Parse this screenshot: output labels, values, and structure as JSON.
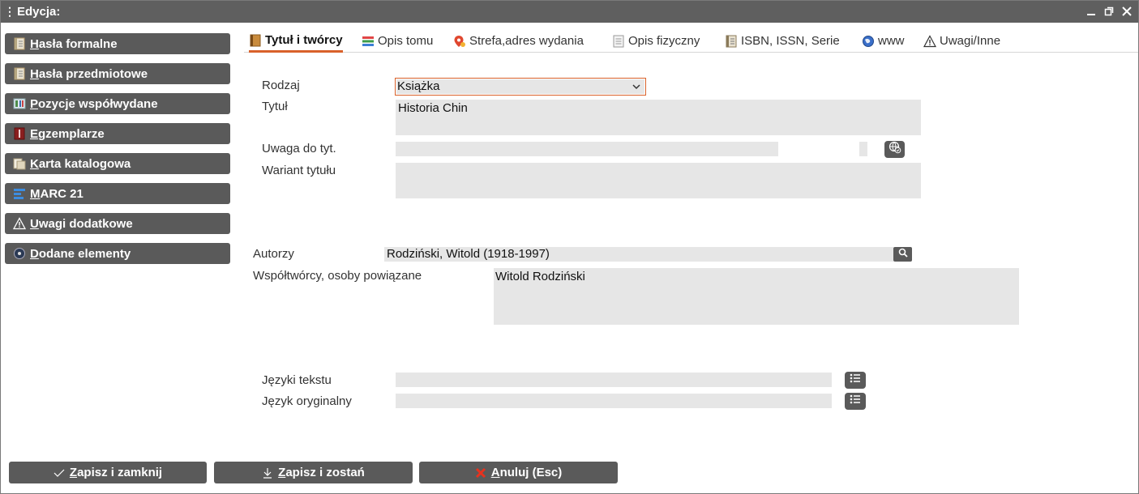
{
  "window": {
    "title": "Edycja:"
  },
  "sidebar": {
    "items": [
      {
        "label": "Hasła formalne",
        "icon": "book-icon"
      },
      {
        "label": "Hasła przedmiotowe",
        "icon": "book-icon"
      },
      {
        "label": "Pozycje współwydane",
        "icon": "columns-icon"
      },
      {
        "label": "Egzemplarze",
        "icon": "copy-icon"
      },
      {
        "label": "Karta katalogowa",
        "icon": "card-icon"
      },
      {
        "label": "MARC 21",
        "icon": "marc-icon"
      },
      {
        "label": "Uwagi dodatkowe",
        "icon": "warning-icon"
      },
      {
        "label": "Dodane elementy",
        "icon": "disc-icon"
      }
    ]
  },
  "tabs": [
    {
      "label": "Tytuł i twórcy",
      "icon": "book-icon",
      "active": true
    },
    {
      "label": "Opis tomu",
      "icon": "stack-icon",
      "active": false
    },
    {
      "label": "Strefa,adres wydania",
      "icon": "location-icon",
      "active": false
    },
    {
      "label": "Opis fizyczny",
      "icon": "document-icon",
      "active": false
    },
    {
      "label": "ISBN, ISSN, Serie",
      "icon": "book-icon",
      "active": false
    },
    {
      "label": "www",
      "icon": "globe-icon",
      "active": false
    },
    {
      "label": "Uwagi/Inne",
      "icon": "warning-icon",
      "active": false
    }
  ],
  "form": {
    "rodzaj": {
      "label": "Rodzaj",
      "value": "Książka"
    },
    "tytul": {
      "label": "Tytuł",
      "value": "Historia Chin"
    },
    "uwaga": {
      "label": "Uwaga do tyt.",
      "value": "",
      "extra": ""
    },
    "wariant": {
      "label": "Wariant tytułu",
      "value": ""
    },
    "autorzy": {
      "label": "Autorzy",
      "value": "Rodziński, Witold (1918-1997)"
    },
    "wspoltworcy": {
      "label": "Współtwórcy, osoby powiązane",
      "value": "Witold Rodziński"
    },
    "jezyki": {
      "label": "Języki tekstu",
      "value": ""
    },
    "jezyk_oryg": {
      "label": "Język oryginalny",
      "value": ""
    }
  },
  "buttons": {
    "save_close": "Zapisz i zamknij",
    "save_stay": "Zapisz i zostań",
    "cancel": "Anuluj (Esc)"
  },
  "colors": {
    "accent": "#d9612a",
    "button_bg": "#5a5a5a",
    "field_bg": "#e6e6e6",
    "titlebar": "#5f5f5f"
  }
}
